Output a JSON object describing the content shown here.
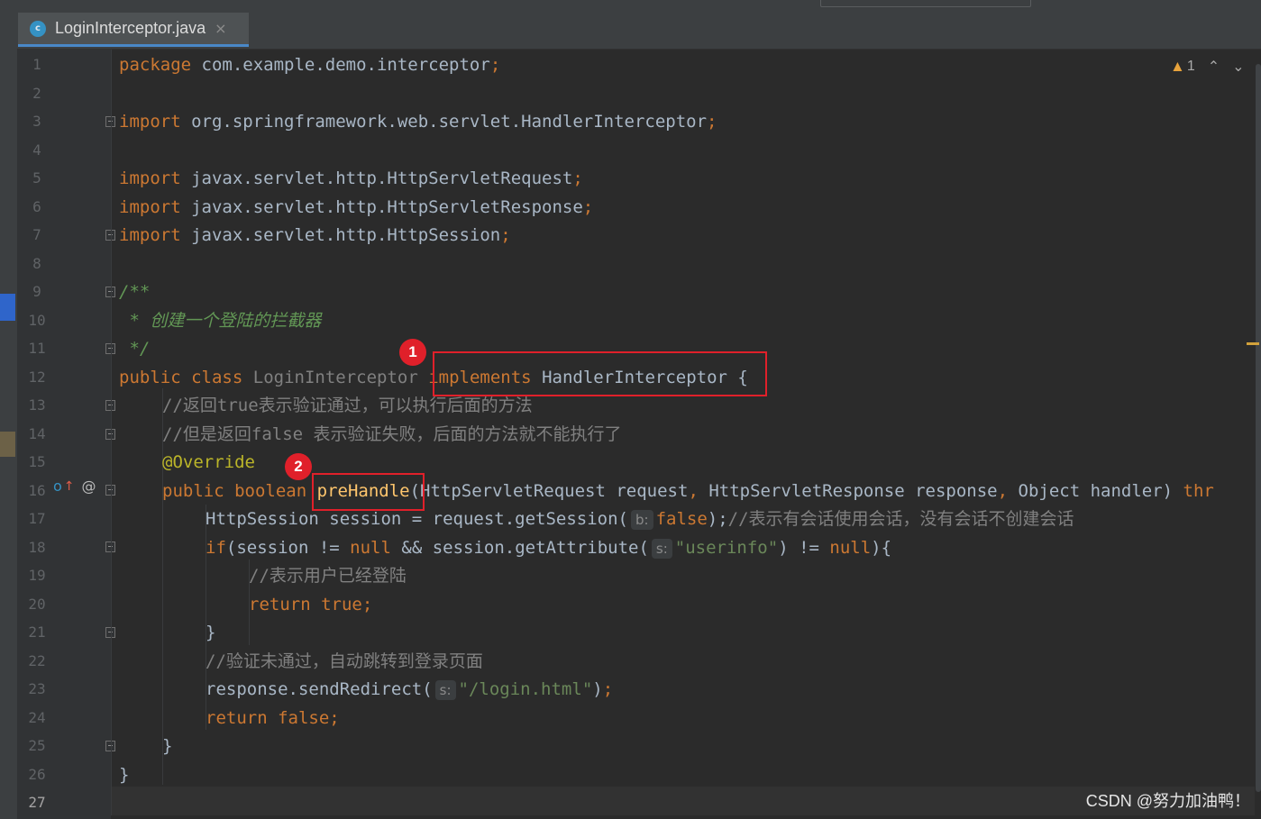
{
  "tab": {
    "icon_letter": "c",
    "file_name": "LoginInterceptor.java",
    "close": "×"
  },
  "status": {
    "warning_count": "1",
    "up": "⌃",
    "down": "⌄"
  },
  "gutter": {
    "line_numbers": [
      "1",
      "2",
      "3",
      "4",
      "5",
      "6",
      "7",
      "8",
      "9",
      "10",
      "11",
      "12",
      "13",
      "14",
      "15",
      "16",
      "17",
      "18",
      "19",
      "20",
      "21",
      "22",
      "23",
      "24",
      "25",
      "26",
      "27"
    ],
    "line16_marker_up": "↑",
    "line16_marker_at": "@"
  },
  "code": {
    "l1": {
      "kw": "package",
      "text": " com.example.demo.interceptor",
      "semi": ";"
    },
    "l3": {
      "kw": "import",
      "text": " org.springframework.web.servlet.HandlerInterceptor",
      "semi": ";"
    },
    "l5": {
      "kw": "import",
      "text": " javax.servlet.http.HttpServletRequest",
      "semi": ";"
    },
    "l6": {
      "kw": "import",
      "text": " javax.servlet.http.HttpServletResponse",
      "semi": ";"
    },
    "l7": {
      "kw": "import",
      "text": " javax.servlet.http.HttpSession",
      "semi": ";"
    },
    "l9": "/**",
    "l10": " * 创建一个登陆的拦截器",
    "l11": " */",
    "l12": {
      "kw1": "public",
      "kw2": "class",
      "name": "LoginInterceptor",
      "kw3": "implements",
      "iface": "HandlerInterceptor",
      "brace": " {"
    },
    "l13": "//返回true表示验证通过，可以执行后面的方法",
    "l14": "//但是返回false 表示验证失败，后面的方法就不能执行了",
    "l15": "@Override",
    "l16": {
      "kw1": "public",
      "kw2": "boolean",
      "method": "preHandle",
      "params1": "(HttpServletRequest request",
      "comma1": ",",
      "params2": " HttpServletResponse response",
      "comma2": ",",
      "params3": " Object handler) ",
      "kw3": "thr"
    },
    "l17": {
      "type": "HttpSession session = request.getSession(",
      "hint": "b:",
      "val": "false",
      "close": ");",
      "cmt": "//表示有会话使用会话，没有会话不创建会话"
    },
    "l18": {
      "kw": "if",
      "a": "(session != ",
      "null1": "null",
      "b": " && session.getAttribute(",
      "hint": "s:",
      "str": "\"userinfo\"",
      "c": ") != ",
      "null2": "null",
      "d": "){"
    },
    "l19": "//表示用户已经登陆",
    "l20": {
      "kw1": "return",
      "kw2": " true",
      "semi": ";"
    },
    "l21": "}",
    "l22": "//验证未通过，自动跳转到登录页面",
    "l23": {
      "a": "response.sendRedirect(",
      "hint": "s:",
      "str": "\"/login.html\"",
      "b": ")",
      "semi": ";"
    },
    "l24": {
      "kw1": "return",
      "kw2": " false",
      "semi": ";"
    },
    "l25": "}",
    "l26": "}"
  },
  "annotations": {
    "badge1": "1",
    "badge2": "2"
  },
  "watermark": "CSDN @努力加油鸭！"
}
